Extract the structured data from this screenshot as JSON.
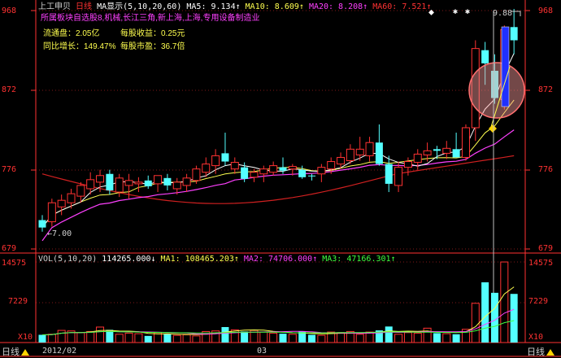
{
  "header": {
    "stock_name": "上工申贝",
    "period": "日线",
    "ma_title": "MA显示(5,10,20,60)",
    "ma5": "MA5: 9.134↑",
    "ma10": "MA10: 8.609↑",
    "ma20": "MA20: 8.208↑",
    "ma60": "MA60: 7.521↑"
  },
  "sector_line": "所属板块自选股8,机械,长江三角,新上海,上海,专用设备制造业",
  "info": {
    "float_cap_label": "流通盘：",
    "float_cap_value": "2.05亿",
    "eps_label": "每股收益：",
    "eps_value": "0.25元",
    "growth_label": "同比增长：",
    "growth_value": "149.47%",
    "pe_label": "每股市盈：",
    "pe_value": "36.7倍"
  },
  "price_axis": {
    "left": [
      "968",
      "872",
      "776",
      "679"
    ],
    "right": [
      "968",
      "872",
      "776",
      "679"
    ]
  },
  "low_marker": "7.00",
  "high_marker": "9.88",
  "star_marks": [
    "⬥",
    "✱",
    "✱"
  ],
  "volume": {
    "title": "VOL(5,10,20)",
    "value": "114265.000↓",
    "ma1": "MA1: 108465.203↑",
    "ma2": "MA2: 74706.000↑",
    "ma3": "MA3: 47166.301↑",
    "axis_left": [
      "14575",
      "7229",
      "X10"
    ],
    "axis_right": [
      "14575",
      "7229",
      "X10"
    ]
  },
  "bottom_bar": {
    "left_tab": "日线",
    "date_start": "2012/02",
    "date_mid": "03",
    "right_tab": "日线"
  },
  "chart_data": {
    "type": "candlestick",
    "ylim": [
      679,
      968
    ],
    "candles": [
      {
        "o": 714,
        "h": 720,
        "l": 700,
        "c": 705,
        "up": false
      },
      {
        "o": 712,
        "h": 740,
        "l": 706,
        "c": 735,
        "up": true
      },
      {
        "o": 730,
        "h": 745,
        "l": 720,
        "c": 738,
        "up": true
      },
      {
        "o": 735,
        "h": 752,
        "l": 728,
        "c": 746,
        "up": true
      },
      {
        "o": 743,
        "h": 760,
        "l": 735,
        "c": 756,
        "up": true
      },
      {
        "o": 752,
        "h": 772,
        "l": 745,
        "c": 763,
        "up": true
      },
      {
        "o": 760,
        "h": 775,
        "l": 748,
        "c": 768,
        "up": true
      },
      {
        "o": 770,
        "h": 775,
        "l": 745,
        "c": 750,
        "up": false
      },
      {
        "o": 748,
        "h": 770,
        "l": 742,
        "c": 765,
        "up": true
      },
      {
        "o": 762,
        "h": 770,
        "l": 740,
        "c": 756,
        "up": true
      },
      {
        "o": 758,
        "h": 766,
        "l": 748,
        "c": 760,
        "up": true
      },
      {
        "o": 762,
        "h": 768,
        "l": 752,
        "c": 755,
        "up": false
      },
      {
        "o": 758,
        "h": 765,
        "l": 748,
        "c": 768,
        "up": true
      },
      {
        "o": 765,
        "h": 770,
        "l": 750,
        "c": 756,
        "up": false
      },
      {
        "o": 752,
        "h": 765,
        "l": 745,
        "c": 760,
        "up": true
      },
      {
        "o": 756,
        "h": 770,
        "l": 748,
        "c": 765,
        "up": true
      },
      {
        "o": 762,
        "h": 780,
        "l": 758,
        "c": 776,
        "up": true
      },
      {
        "o": 772,
        "h": 790,
        "l": 766,
        "c": 782,
        "up": true
      },
      {
        "o": 780,
        "h": 800,
        "l": 770,
        "c": 792,
        "up": true
      },
      {
        "o": 795,
        "h": 820,
        "l": 780,
        "c": 785,
        "up": false
      },
      {
        "o": 784,
        "h": 790,
        "l": 770,
        "c": 776,
        "up": true
      },
      {
        "o": 778,
        "h": 784,
        "l": 760,
        "c": 764,
        "up": false
      },
      {
        "o": 766,
        "h": 776,
        "l": 760,
        "c": 772,
        "up": true
      },
      {
        "o": 770,
        "h": 780,
        "l": 760,
        "c": 776,
        "up": true
      },
      {
        "o": 772,
        "h": 785,
        "l": 768,
        "c": 780,
        "up": true
      },
      {
        "o": 778,
        "h": 790,
        "l": 770,
        "c": 774,
        "up": false
      },
      {
        "o": 776,
        "h": 782,
        "l": 768,
        "c": 779,
        "up": true
      },
      {
        "o": 775,
        "h": 780,
        "l": 764,
        "c": 766,
        "up": false
      },
      {
        "o": 767,
        "h": 770,
        "l": 762,
        "c": 768,
        "up": false
      },
      {
        "o": 770,
        "h": 782,
        "l": 760,
        "c": 778,
        "up": true
      },
      {
        "o": 776,
        "h": 790,
        "l": 770,
        "c": 785,
        "up": true
      },
      {
        "o": 782,
        "h": 796,
        "l": 776,
        "c": 790,
        "up": true
      },
      {
        "o": 786,
        "h": 806,
        "l": 782,
        "c": 800,
        "up": true
      },
      {
        "o": 800,
        "h": 815,
        "l": 786,
        "c": 793,
        "up": true
      },
      {
        "o": 792,
        "h": 815,
        "l": 785,
        "c": 808,
        "up": true
      },
      {
        "o": 808,
        "h": 830,
        "l": 780,
        "c": 782,
        "up": false
      },
      {
        "o": 782,
        "h": 792,
        "l": 748,
        "c": 758,
        "up": false
      },
      {
        "o": 756,
        "h": 785,
        "l": 748,
        "c": 778,
        "up": true
      },
      {
        "o": 778,
        "h": 790,
        "l": 768,
        "c": 785,
        "up": true
      },
      {
        "o": 784,
        "h": 800,
        "l": 775,
        "c": 794,
        "up": true
      },
      {
        "o": 793,
        "h": 808,
        "l": 785,
        "c": 798,
        "up": true
      },
      {
        "o": 798,
        "h": 804,
        "l": 788,
        "c": 800,
        "up": false
      },
      {
        "o": 795,
        "h": 810,
        "l": 788,
        "c": 801,
        "up": true
      },
      {
        "o": 800,
        "h": 820,
        "l": 794,
        "c": 790,
        "up": false
      },
      {
        "o": 790,
        "h": 830,
        "l": 786,
        "c": 826,
        "up": true
      },
      {
        "o": 826,
        "h": 932,
        "l": 810,
        "c": 922,
        "up": true
      },
      {
        "o": 920,
        "h": 930,
        "l": 878,
        "c": 904,
        "up": false
      },
      {
        "o": 895,
        "h": 915,
        "l": 855,
        "c": 862,
        "up": false
      },
      {
        "o": 860,
        "h": 950,
        "l": 848,
        "c": 945,
        "up": true
      },
      {
        "o": 932,
        "h": 970,
        "l": 915,
        "c": 948,
        "up": false
      }
    ],
    "volumes": [
      1400,
      1500,
      2200,
      2100,
      1800,
      2000,
      2800,
      2300,
      1500,
      1700,
      1600,
      1200,
      1800,
      1600,
      1300,
      1400,
      1200,
      2000,
      2100,
      2800,
      2300,
      2000,
      2200,
      1900,
      1700,
      1600,
      1500,
      2000,
      1400,
      1300,
      1900,
      1800,
      2000,
      1500,
      1900,
      2200,
      2900,
      1500,
      1800,
      1700,
      2600,
      1700,
      1600,
      1500,
      2400,
      7100,
      10900,
      9000,
      14575,
      8800
    ],
    "volume_up": [
      false,
      true,
      true,
      true,
      true,
      true,
      true,
      false,
      true,
      true,
      true,
      false,
      true,
      false,
      true,
      true,
      true,
      true,
      true,
      false,
      true,
      false,
      true,
      true,
      true,
      false,
      true,
      false,
      false,
      true,
      true,
      true,
      true,
      true,
      true,
      false,
      false,
      true,
      true,
      true,
      true,
      false,
      true,
      false,
      true,
      true,
      false,
      false,
      true,
      false
    ]
  }
}
